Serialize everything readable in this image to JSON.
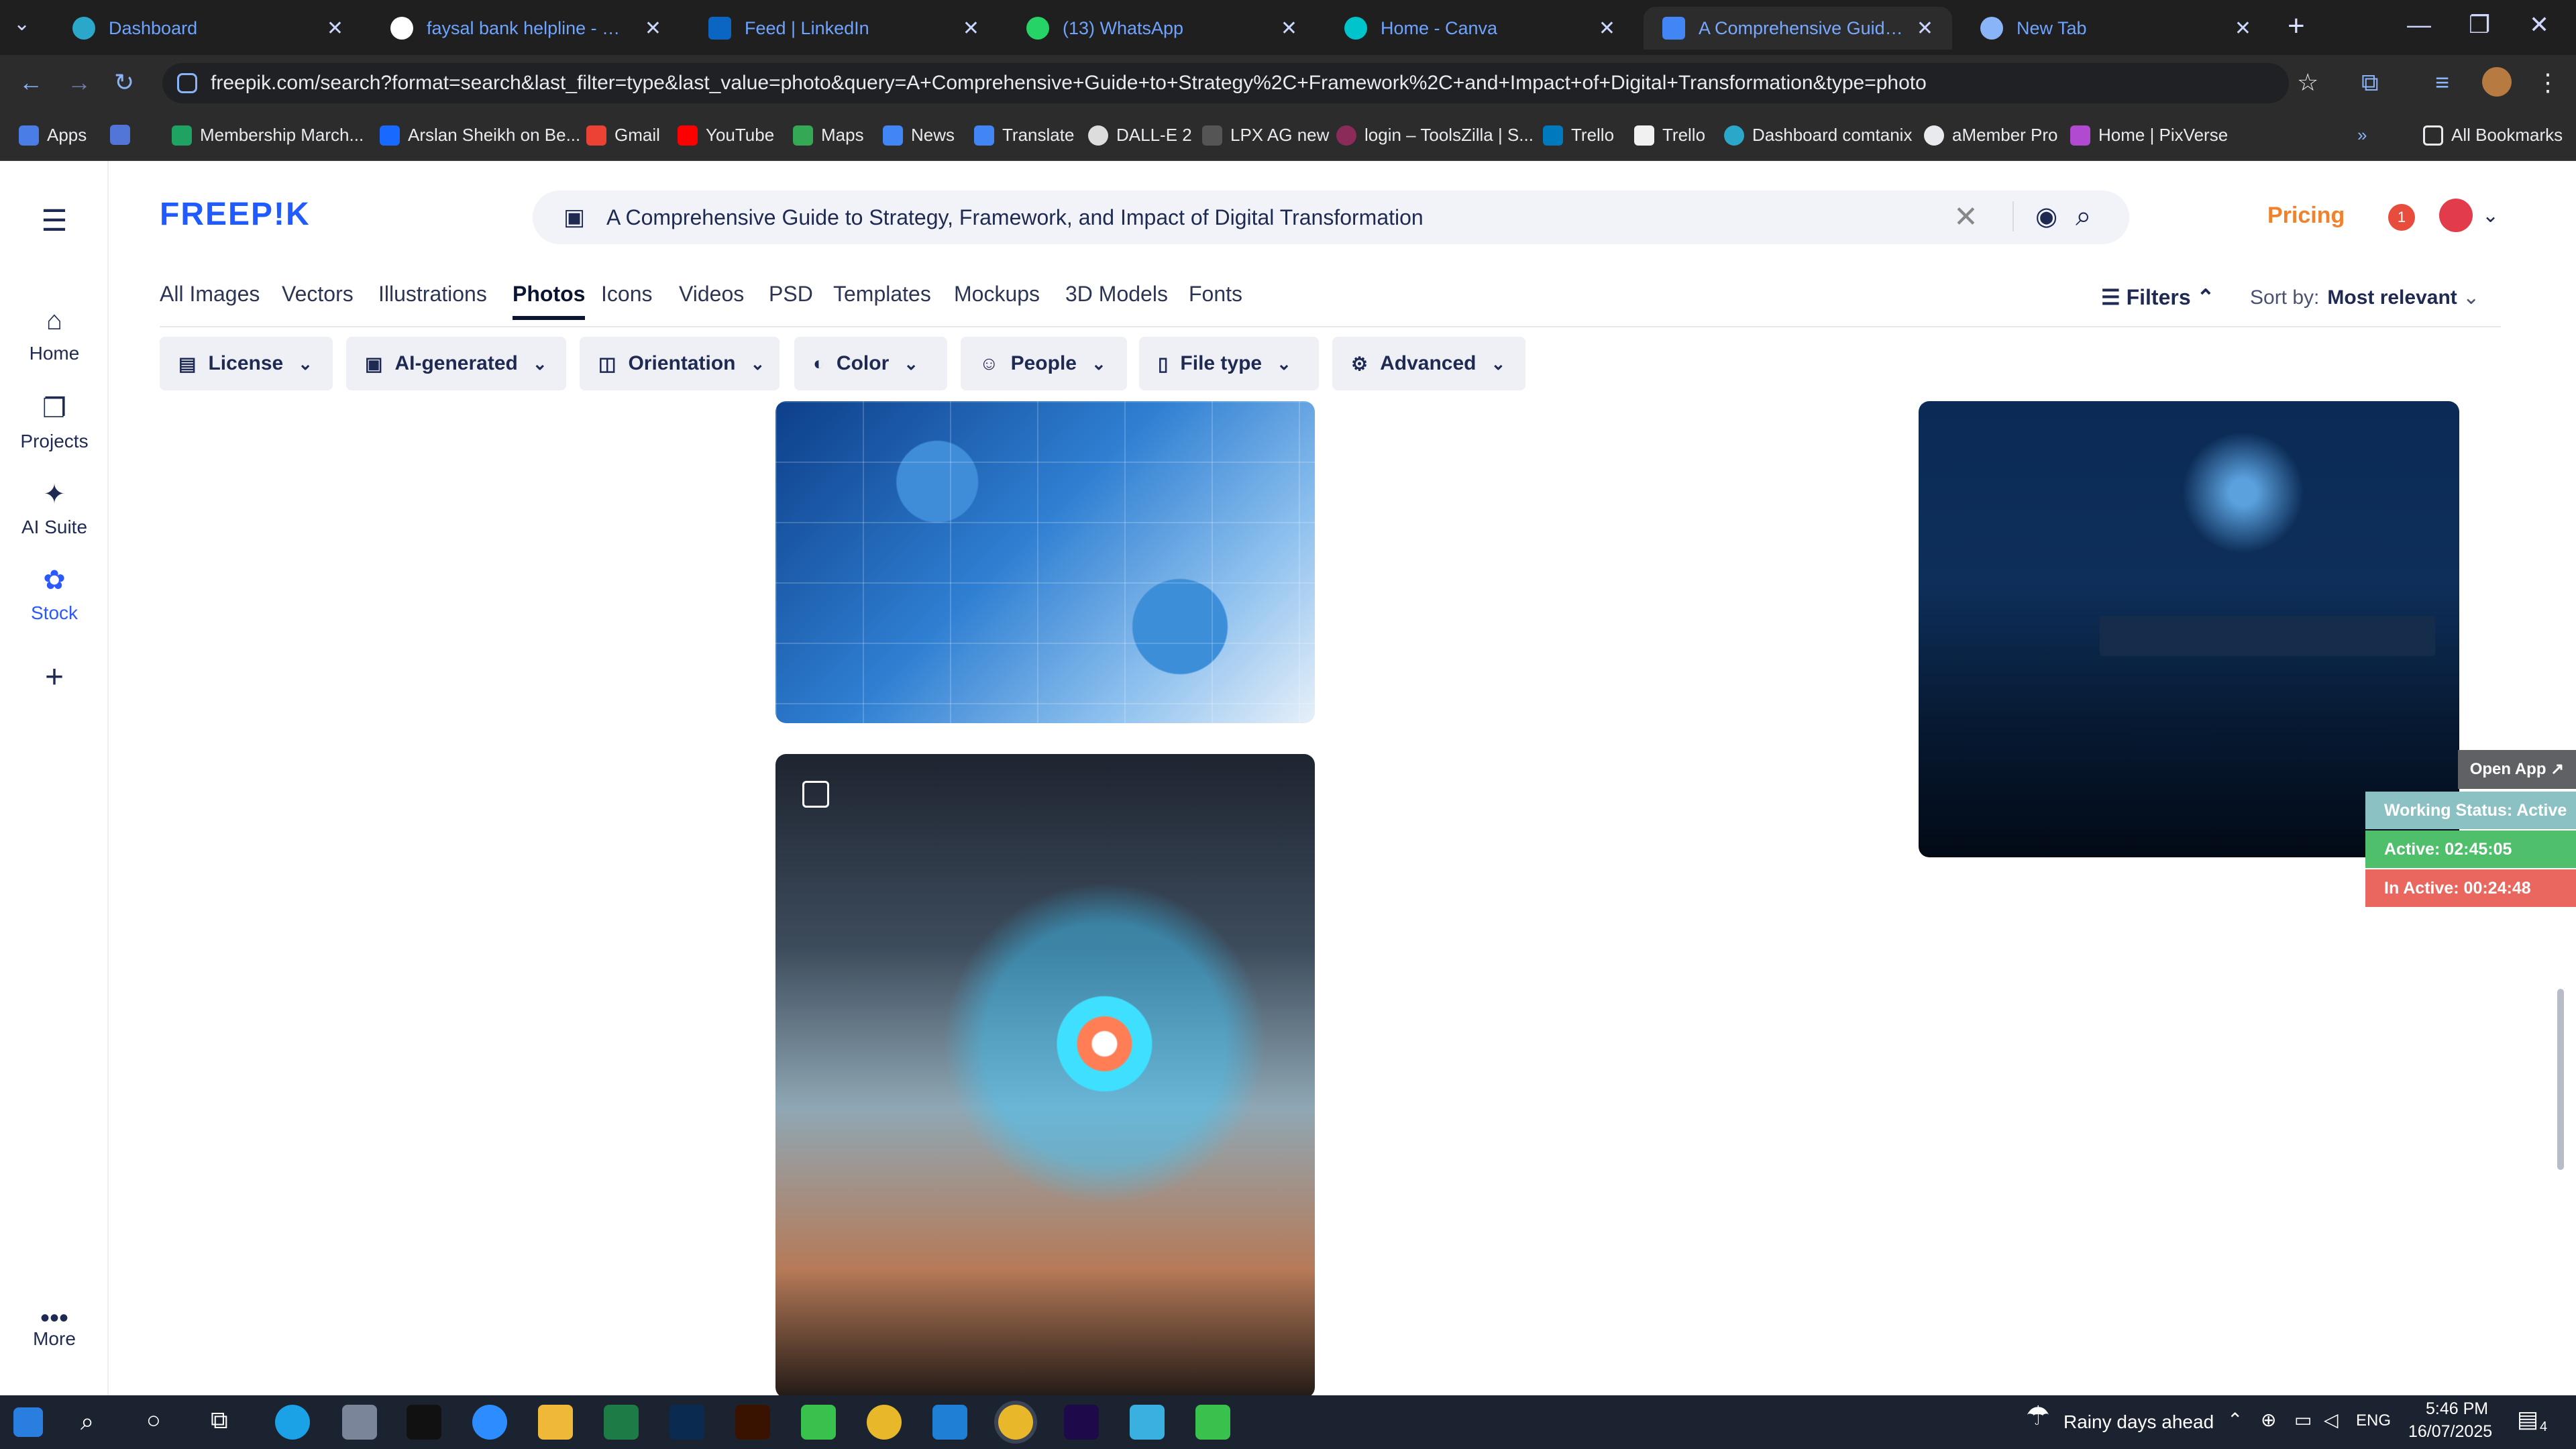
{
  "browser": {
    "tabs": [
      {
        "title": "Dashboard",
        "color": "#2aa7c9"
      },
      {
        "title": "faysal bank helpline - Google S",
        "color": "#ffffff"
      },
      {
        "title": "Feed | LinkedIn",
        "color": "#0a66c2"
      },
      {
        "title": "(13) WhatsApp",
        "color": "#25d366"
      },
      {
        "title": "Home - Canva",
        "color": "#00c4cc"
      },
      {
        "title": "A Comprehensive Guide to Stra",
        "color": "#4285f4"
      },
      {
        "title": "New Tab",
        "color": "#8ab4f8"
      }
    ],
    "url": "freepik.com/search?format=search&last_filter=type&last_value=photo&query=A+Comprehensive+Guide+to+Strategy%2C+Framework%2C+and+Impact+of+Digital+Transformation&type=photo",
    "bookmarks": [
      "Apps",
      "Membership March...",
      "Arslan Sheikh on Be...",
      "Gmail",
      "YouTube",
      "Maps",
      "News",
      "Translate",
      "DALL-E 2",
      "LPX AG new",
      "login – ToolsZilla | S...",
      "Trello",
      "Trello",
      "Dashboard comtanix",
      "aMember Pro",
      "Home | PixVerse"
    ],
    "all_bookmarks": "All Bookmarks"
  },
  "rail": {
    "home": "Home",
    "projects": "Projects",
    "ai_suite": "AI Suite",
    "stock": "Stock",
    "more": "More"
  },
  "header": {
    "logo": "FREEP!K",
    "search_value": "A Comprehensive Guide to Strategy, Framework, and Impact of Digital Transformation",
    "pricing": "Pricing",
    "notification_count": "1"
  },
  "categories": [
    "All Images",
    "Vectors",
    "Illustrations",
    "Photos",
    "Icons",
    "Videos",
    "PSD",
    "Templates",
    "Mockups",
    "3D Models",
    "Fonts"
  ],
  "filters_label": "Filters",
  "sort": {
    "label": "Sort by:",
    "value": "Most relevant"
  },
  "filter_pills": [
    "License",
    "AI-generated",
    "Orientation",
    "Color",
    "People",
    "File type",
    "Advanced"
  ],
  "work_status": {
    "open_app": "Open App ↗",
    "status": "Working Status: Active",
    "active": "Active: 02:45:05",
    "inactive": "In Active: 00:24:48"
  },
  "taskbar": {
    "weather": "Rainy days ahead",
    "lang": "ENG",
    "time": "5:46 PM",
    "date": "16/07/2025",
    "notifications": "4"
  }
}
